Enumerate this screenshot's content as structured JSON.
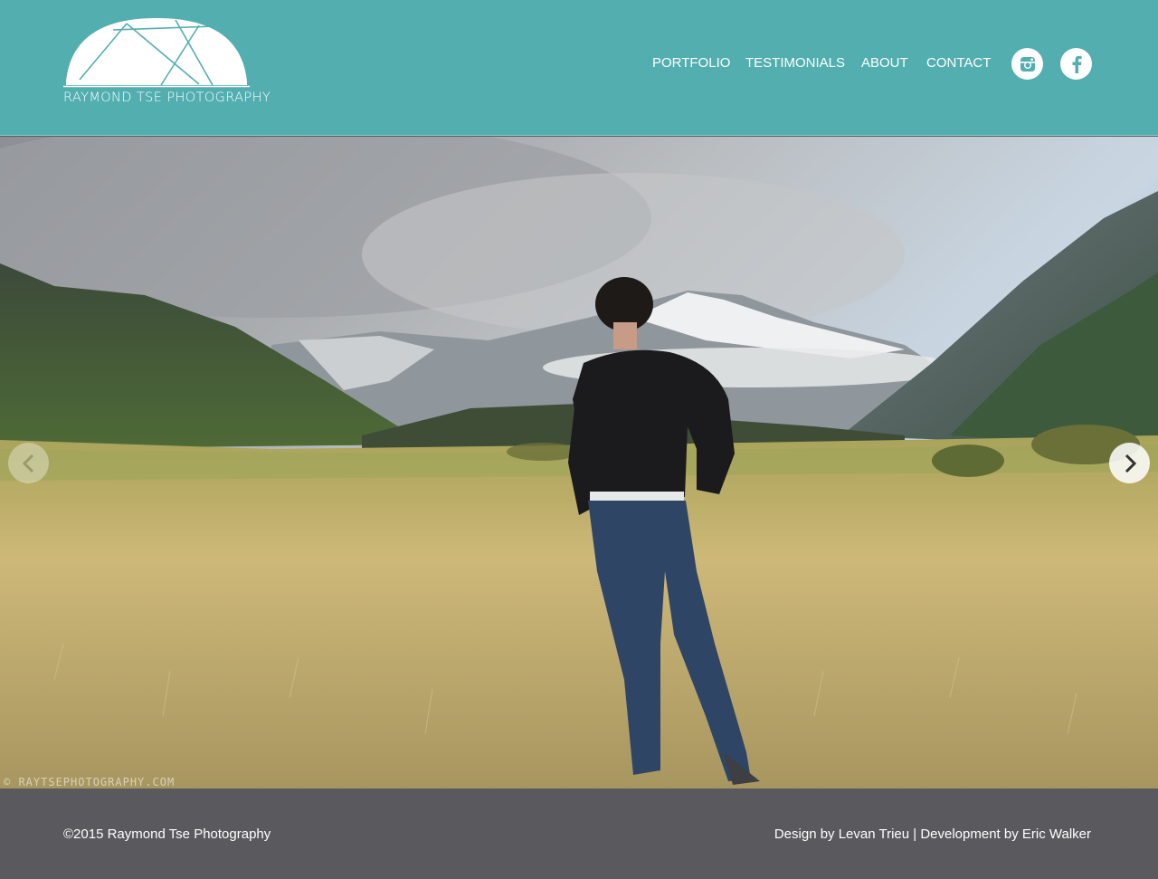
{
  "brand": {
    "logo_text": "RAYMOND TSE PHOTOGRAPHY"
  },
  "nav": {
    "items": [
      {
        "label": "PORTFOLIO"
      },
      {
        "label": "TESTIMONIALS"
      },
      {
        "label": "ABOUT"
      },
      {
        "label": "CONTACT"
      }
    ],
    "social": [
      {
        "icon": "instagram-icon"
      },
      {
        "icon": "facebook-icon"
      }
    ]
  },
  "hero": {
    "watermark": "© RAYTSEPHOTOGRAPHY.COM",
    "prev_icon": "chevron-left-icon",
    "next_icon": "chevron-right-icon"
  },
  "footer": {
    "copyright": "©2015 Raymond Tse Photography",
    "credits": "Design by Levan Trieu | Development by Eric Walker"
  },
  "colors": {
    "header_bg": "#52aeaf",
    "footer_bg": "#5a5a5e",
    "text": "#ffffff"
  }
}
